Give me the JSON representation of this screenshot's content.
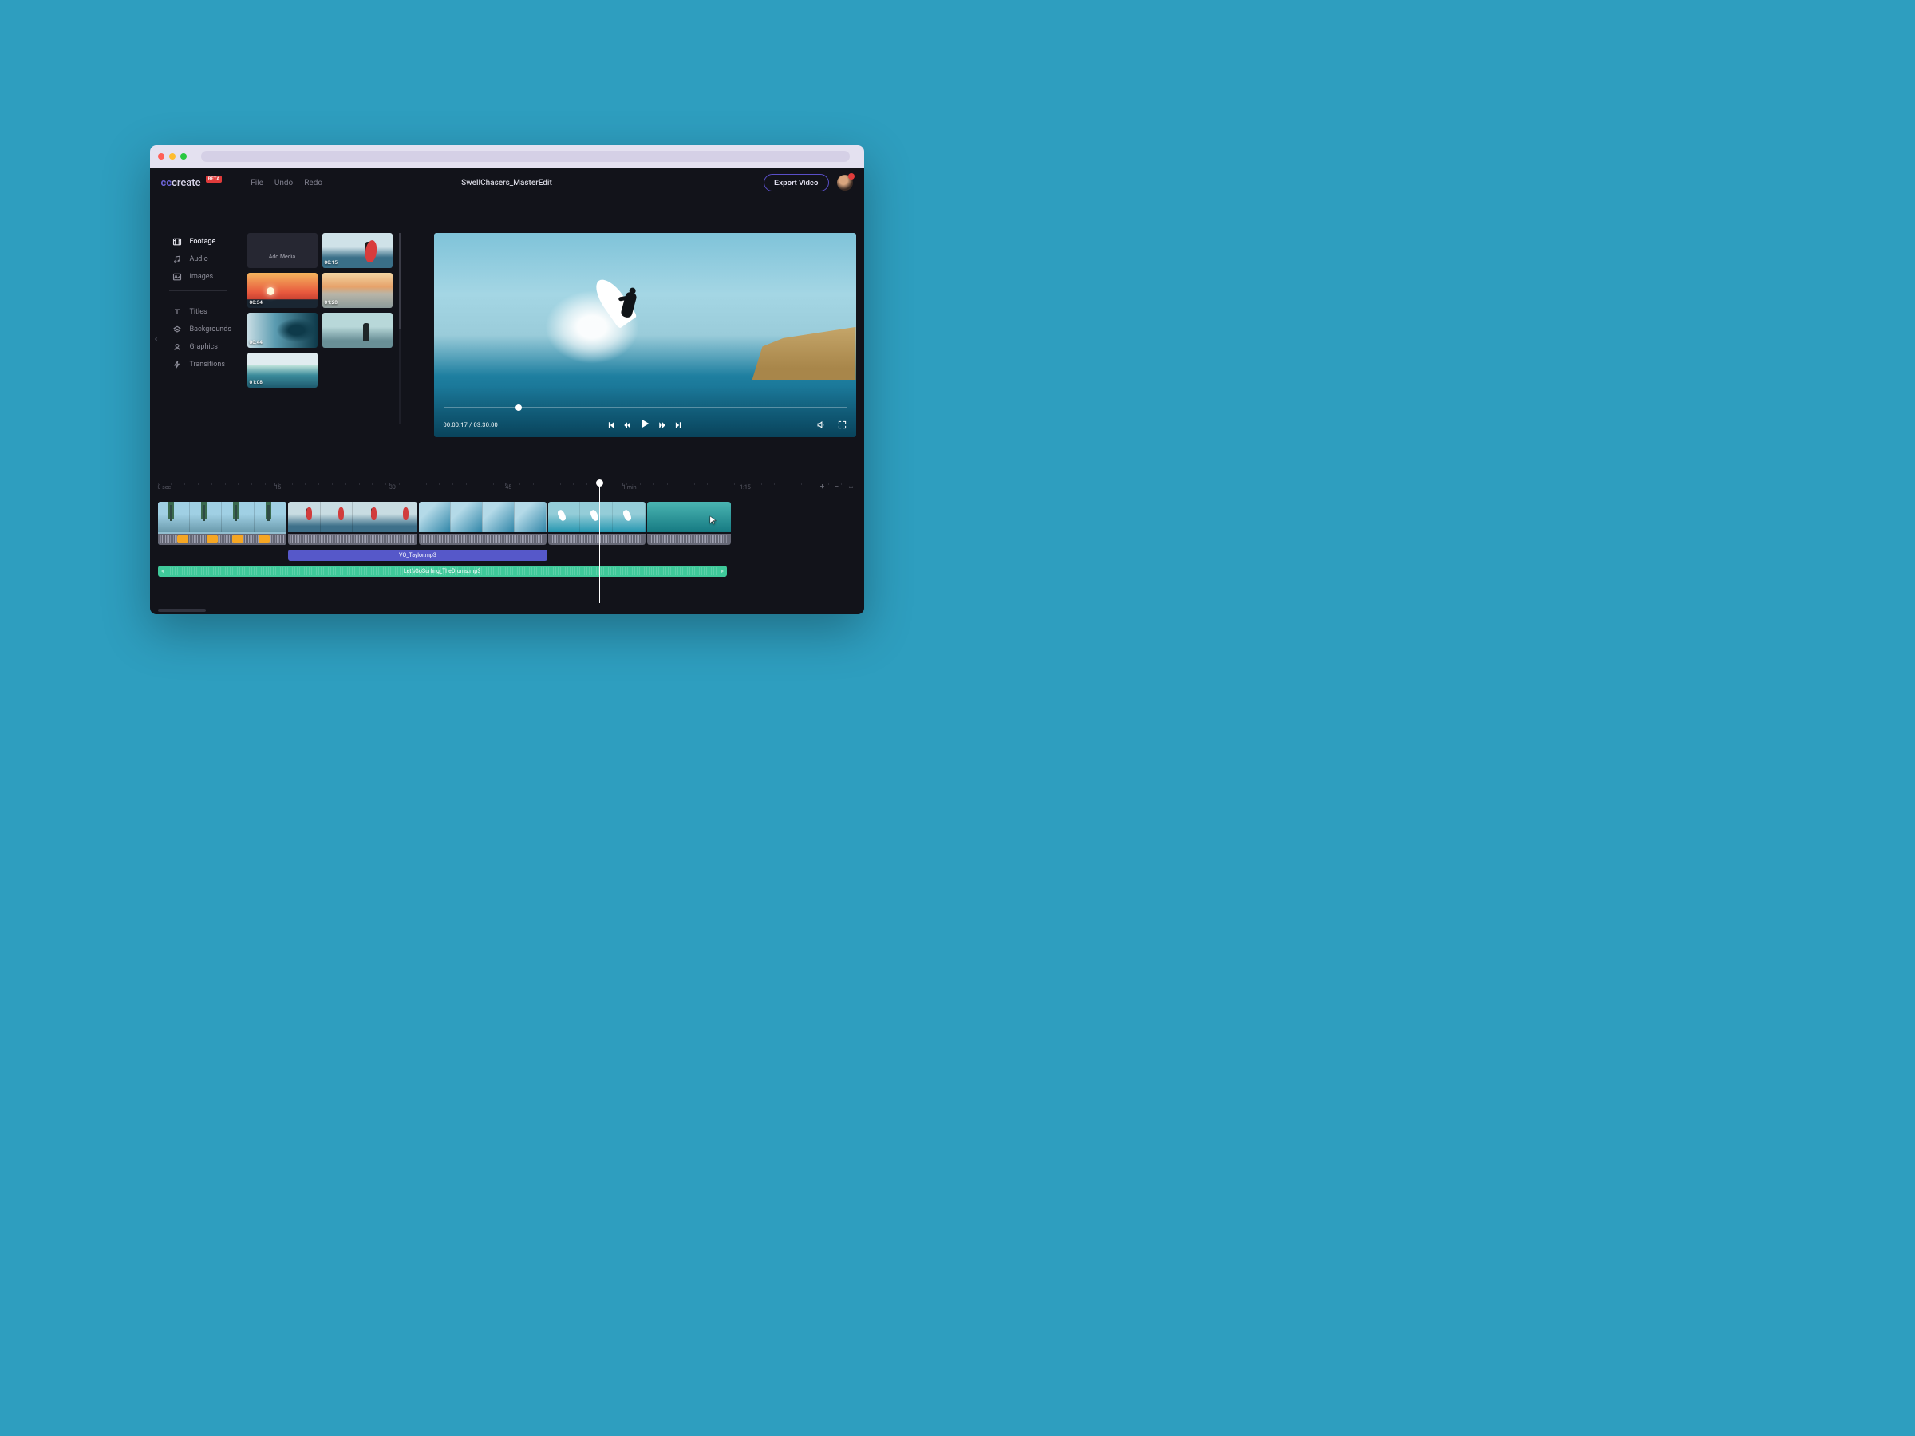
{
  "app": {
    "logo_prefix": "cc",
    "logo_suffix": "create",
    "badge": "BETA"
  },
  "topbar": {
    "menus": [
      "File",
      "Undo",
      "Redo"
    ],
    "project_title": "SwellChasers_MasterEdit",
    "export_label": "Export Video"
  },
  "sidebar": {
    "group1": [
      {
        "label": "Footage",
        "icon": "film-icon",
        "active": true
      },
      {
        "label": "Audio",
        "icon": "music-icon"
      },
      {
        "label": "Images",
        "icon": "image-icon"
      }
    ],
    "group2": [
      {
        "label": "Titles",
        "icon": "text-icon"
      },
      {
        "label": "Backgrounds",
        "icon": "layers-icon"
      },
      {
        "label": "Graphics",
        "icon": "graphics-icon"
      },
      {
        "label": "Transitions",
        "icon": "bolt-icon"
      }
    ]
  },
  "media": {
    "add_label": "Add Media",
    "clips": [
      {
        "duration": "00:15",
        "kind": "surfboard"
      },
      {
        "duration": "00:34",
        "kind": "sunset"
      },
      {
        "duration": "01:28",
        "kind": "sunset-waves"
      },
      {
        "duration": "00:44",
        "kind": "barrel"
      },
      {
        "duration": "",
        "kind": "silhouette"
      },
      {
        "duration": "01:08",
        "kind": "wave"
      }
    ]
  },
  "preview": {
    "time_current": "00:00:17",
    "time_total": "03:30:00"
  },
  "timeline": {
    "ticks": [
      {
        "label": "0 sec",
        "pct": 0
      },
      {
        "label": "15",
        "pct": 16.8
      },
      {
        "label": "30",
        "pct": 33.2
      },
      {
        "label": "45",
        "pct": 49.8
      },
      {
        "label": "1 min",
        "pct": 66.6
      },
      {
        "label": "1:15",
        "pct": 83.4
      }
    ],
    "playhead_pct": 61.8,
    "video_clips": [
      {
        "kind": "palm",
        "width": 18.5,
        "frames": 4
      },
      {
        "kind": "surf",
        "width": 18.5,
        "frames": 4
      },
      {
        "kind": "wave",
        "width": 18.2,
        "frames": 4
      },
      {
        "kind": "air",
        "width": 14.0,
        "frames": 3
      },
      {
        "kind": "aerial",
        "width": 12.0,
        "frames": 1
      }
    ],
    "vo": {
      "label": "VO_Taylor.mp3",
      "left_pct": 18.7,
      "width_pct": 37.1
    },
    "music": {
      "label": "Let'sGoSurfing_TheDrums.mp3",
      "left_pct": 0,
      "width_pct": 81.5
    }
  },
  "colors": {
    "accent_violet": "#5a4fc9",
    "accent_green": "#3fc99a",
    "accent_orange": "#f5a623",
    "accent_red": "#e03b3b",
    "bg_dark": "#12131a"
  }
}
